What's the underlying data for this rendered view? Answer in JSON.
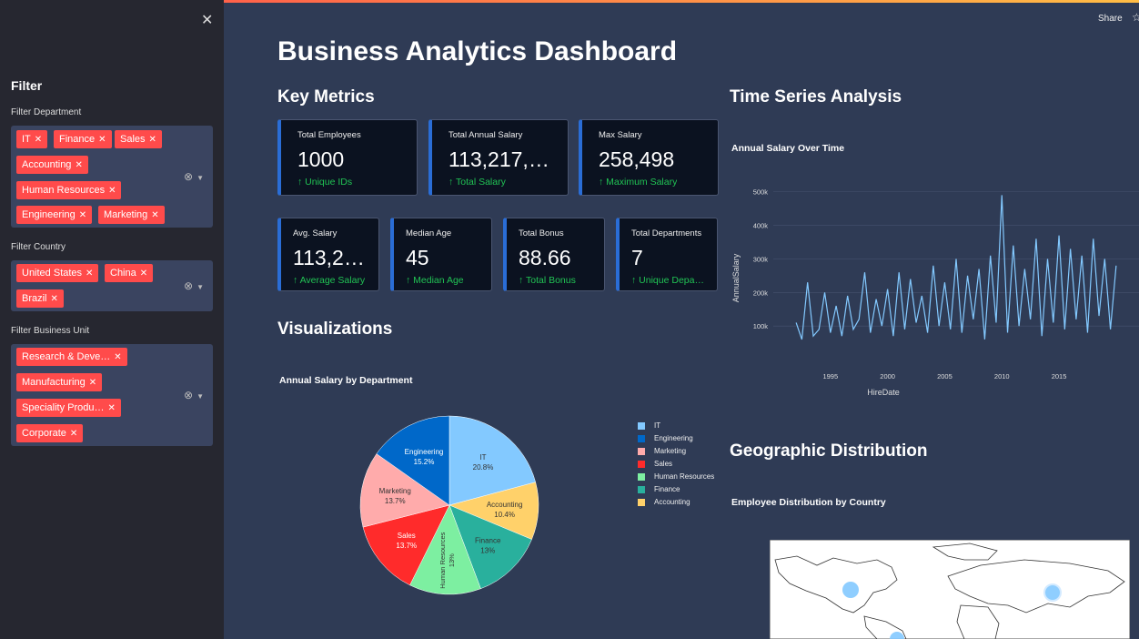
{
  "sidebar": {
    "close_icon": "close-icon",
    "filter_title": "Filter",
    "department": {
      "label": "Filter Department",
      "tags": [
        "IT",
        "Finance",
        "Sales",
        "Accounting",
        "Human Resources",
        "Engineering",
        "Marketing"
      ]
    },
    "country": {
      "label": "Filter Country",
      "tags": [
        "United States",
        "China",
        "Brazil"
      ]
    },
    "business_unit": {
      "label": "Filter Business Unit",
      "tags": [
        "Research & Deve…",
        "Manufacturing",
        "Speciality Produ…",
        "Corporate"
      ]
    }
  },
  "header": {
    "share_label": "Share",
    "star_icon": "star-icon"
  },
  "main": {
    "title": "Business Analytics Dashboard",
    "key_metrics_title": "Key Metrics",
    "visualizations_title": "Visualizations",
    "time_series_title": "Time Series Analysis",
    "geo_title": "Geographic Distribution"
  },
  "metrics_row1": [
    {
      "label": "Total Employees",
      "value": "1000",
      "delta": "↑ Unique IDs"
    },
    {
      "label": "Total Annual Salary",
      "value": "113,217,…",
      "delta": "↑ Total Salary"
    },
    {
      "label": "Max Salary",
      "value": "258,498",
      "delta": "↑ Maximum Salary"
    }
  ],
  "metrics_row2": [
    {
      "label": "Avg. Salary",
      "value": "113,2…",
      "delta": "↑ Average Salary"
    },
    {
      "label": "Median Age",
      "value": "45",
      "delta": "↑ Median Age"
    },
    {
      "label": "Total Bonus",
      "value": "88.66",
      "delta": "↑ Total Bonus"
    },
    {
      "label": "Total Departments",
      "value": "7",
      "delta": "↑ Unique Depa…"
    }
  ],
  "colors": {
    "accent": "#ff4b4b",
    "metric_border": "#2a6dd6",
    "delta": "#21c354",
    "line": "#83c9ff"
  },
  "chart_data": [
    {
      "type": "pie",
      "title": "Annual Salary by Department",
      "slices": [
        {
          "label": "IT",
          "value": 20.8,
          "color": "#83c9ff"
        },
        {
          "label": "Accounting",
          "value": 10.4,
          "color": "#ffd16a"
        },
        {
          "label": "Finance",
          "value": 13,
          "color": "#29b09d"
        },
        {
          "label": "Human Resources",
          "value": 13,
          "color": "#7defa1"
        },
        {
          "label": "Sales",
          "value": 13.7,
          "color": "#ff2b2b"
        },
        {
          "label": "Marketing",
          "value": 13.7,
          "color": "#ffabab"
        },
        {
          "label": "Engineering",
          "value": 15.2,
          "color": "#0068c9"
        }
      ],
      "legend": [
        "IT",
        "Engineering",
        "Marketing",
        "Sales",
        "Human Resources",
        "Finance",
        "Accounting"
      ],
      "legend_placement": "right"
    },
    {
      "type": "line",
      "title": "Annual Salary Over Time",
      "xlabel": "HireDate",
      "ylabel": "AnnualSalary",
      "xticks": [
        "1995",
        "2000",
        "2005",
        "2010",
        "2015"
      ],
      "yticks": [
        "100k",
        "200k",
        "300k",
        "400k",
        "500k"
      ],
      "xlim": [
        1990,
        2022
      ],
      "ylim": [
        0,
        540000
      ],
      "series": [
        {
          "x": [
            1992,
            1992.5,
            1993,
            1993.5,
            1994,
            1994.5,
            1995,
            1995.5,
            1996,
            1996.5,
            1997,
            1997.5,
            1998,
            1998.5,
            1999,
            1999.5,
            2000,
            2000.5,
            2001,
            2001.5,
            2002,
            2002.5,
            2003,
            2003.5,
            2004,
            2004.5,
            2005,
            2005.5,
            2006,
            2006.5,
            2007,
            2007.5,
            2008,
            2008.5,
            2009,
            2009.5,
            2010,
            2010.5,
            2011,
            2011.5,
            2012,
            2012.5,
            2013,
            2013.5,
            2014,
            2014.5,
            2015,
            2015.5,
            2016,
            2016.5,
            2017,
            2017.5,
            2018,
            2018.5,
            2019,
            2019.5,
            2020
          ],
          "y": [
            110000,
            60000,
            230000,
            70000,
            90000,
            200000,
            80000,
            160000,
            70000,
            190000,
            90000,
            120000,
            260000,
            80000,
            180000,
            100000,
            210000,
            70000,
            260000,
            90000,
            240000,
            110000,
            190000,
            80000,
            280000,
            100000,
            230000,
            90000,
            300000,
            80000,
            250000,
            120000,
            270000,
            60000,
            310000,
            110000,
            490000,
            80000,
            340000,
            100000,
            270000,
            120000,
            360000,
            70000,
            300000,
            110000,
            370000,
            90000,
            330000,
            120000,
            310000,
            80000,
            360000,
            130000,
            300000,
            90000,
            280000
          ]
        }
      ]
    },
    {
      "type": "scatter",
      "title": "Employee Distribution by Country",
      "points": [
        {
          "label": "United States"
        },
        {
          "label": "China"
        },
        {
          "label": "Brazil"
        }
      ]
    }
  ]
}
